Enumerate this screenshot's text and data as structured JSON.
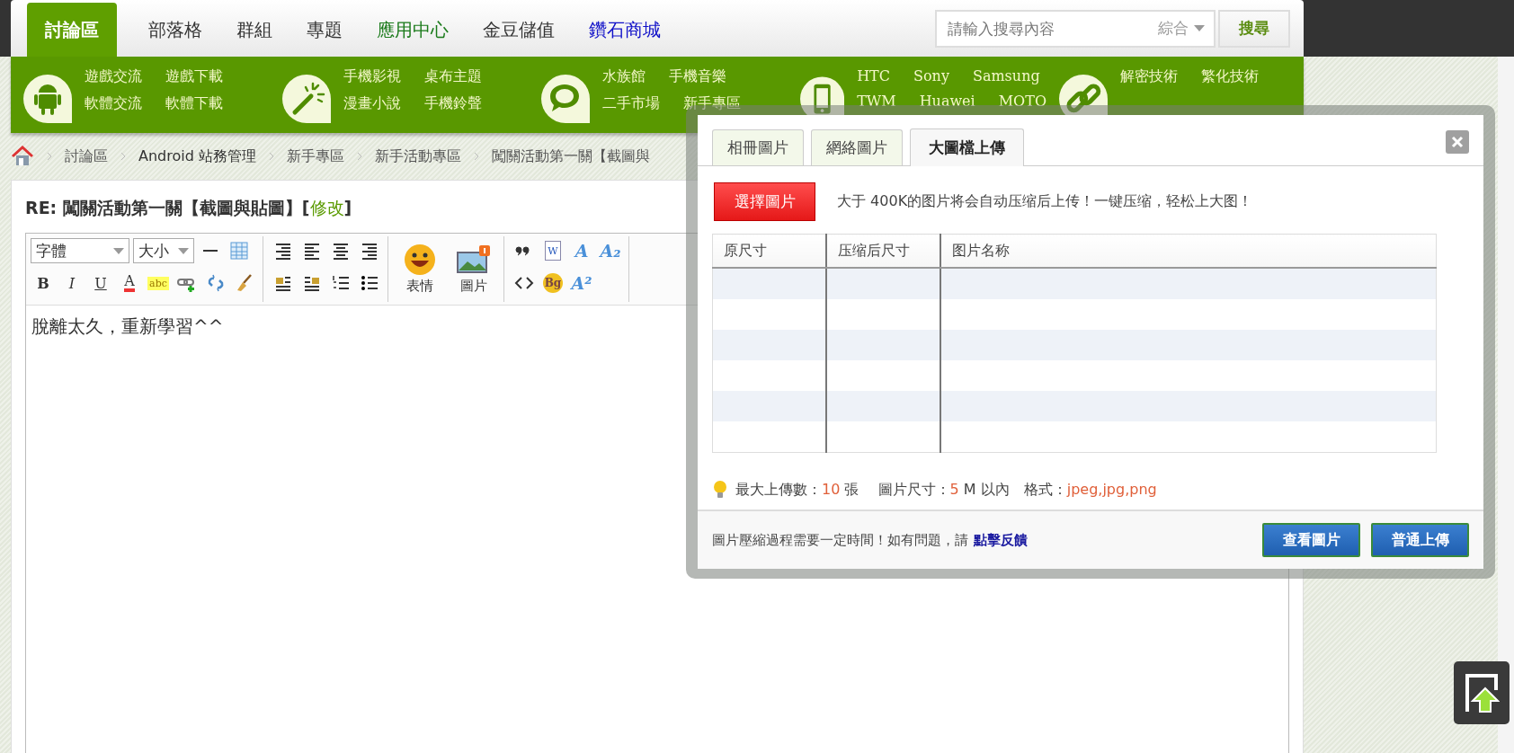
{
  "top_nav": {
    "items": [
      {
        "label": "討論區",
        "selected": true
      },
      {
        "label": "部落格",
        "selected": false,
        "color": "#333333"
      },
      {
        "label": "群組",
        "selected": false,
        "color": "#333333"
      },
      {
        "label": "專題",
        "selected": false,
        "color": "#333333"
      },
      {
        "label": "應用中心",
        "selected": false,
        "color": "#1a7a1a"
      },
      {
        "label": "金豆儲值",
        "selected": false,
        "color": "#333333"
      },
      {
        "label": "鑽石商城",
        "selected": false,
        "color": "#1010c8"
      }
    ],
    "search": {
      "placeholder": "請輸入搜尋內容",
      "scope": "綜合",
      "button": "搜尋"
    }
  },
  "categories": [
    {
      "links": [
        [
          "遊戲交流",
          "遊戲下載"
        ],
        [
          "軟體交流",
          "軟體下載"
        ]
      ]
    },
    {
      "links": [
        [
          "手機影視",
          "桌布主題"
        ],
        [
          "漫畫小說",
          "手機鈴聲"
        ]
      ]
    },
    {
      "links": [
        [
          "水族館",
          "手機音樂"
        ],
        [
          "二手市場",
          "新手專區"
        ]
      ]
    },
    {
      "links": [
        [
          "HTC",
          "Sony",
          "Samsung"
        ],
        [
          "TWM",
          "Huawei",
          "MOTO"
        ]
      ]
    },
    {
      "links": [
        [
          "解密技術",
          "繁化技術"
        ]
      ]
    }
  ],
  "breadcrumb": [
    {
      "label": "討論區",
      "strong": false
    },
    {
      "label": "Android 站務管理",
      "strong": true
    },
    {
      "label": "新手專區",
      "strong": false
    },
    {
      "label": "新手活動專區",
      "strong": false
    },
    {
      "label": "闖關活動第一關【截圖與",
      "strong": false
    }
  ],
  "post": {
    "title": "RE: 闖關活動第一關【截圖與貼圖】[",
    "edit_link": "修改",
    "title_end": "]",
    "toolbar": [
      {
        "top": [
          {
            "kind": "select",
            "label": "字體"
          },
          {
            "kind": "select",
            "label": "大小"
          },
          {
            "kind": "hr"
          },
          {
            "kind": "table"
          }
        ],
        "bottom": [
          {
            "kind": "bold",
            "glyph": "B"
          },
          {
            "kind": "italic",
            "glyph": "I"
          },
          {
            "kind": "underline",
            "glyph": "U"
          },
          {
            "kind": "forecolor",
            "glyph": "A"
          },
          {
            "kind": "highlight",
            "glyph": "abc"
          },
          {
            "kind": "link"
          },
          {
            "kind": "unlink"
          },
          {
            "kind": "eraser"
          }
        ]
      },
      {
        "top": [
          {
            "kind": "align-right"
          },
          {
            "kind": "align-left"
          },
          {
            "kind": "align-center"
          },
          {
            "kind": "align-right"
          }
        ],
        "bottom": [
          {
            "kind": "float-left"
          },
          {
            "kind": "float-right"
          },
          {
            "kind": "ordered-list"
          },
          {
            "kind": "bullet-list"
          }
        ]
      },
      {
        "big": [
          {
            "kind": "emoji",
            "label": "表情"
          },
          {
            "kind": "picture",
            "label": "圖片"
          }
        ]
      },
      {
        "top": [
          {
            "kind": "quote"
          },
          {
            "kind": "doc",
            "glyph": "W"
          },
          {
            "kind": "font",
            "glyph": "A"
          },
          {
            "kind": "font",
            "glyph": "A₂"
          }
        ],
        "bottom": [
          {
            "kind": "code"
          },
          {
            "kind": "bg",
            "glyph": "Bg"
          },
          {
            "kind": "font",
            "glyph": "A²"
          }
        ]
      }
    ],
    "body": "脫離太久，重新學習^^"
  },
  "dialog": {
    "tabs": [
      {
        "label": "相冊圖片",
        "selected": false
      },
      {
        "label": "網絡圖片",
        "selected": false
      },
      {
        "label": "大圖檔上傳",
        "selected": true
      }
    ],
    "choose_button": "選擇圖片",
    "hint": "大于 400K的图片将会自动压缩后上传！一键压缩，轻松上大图！",
    "columns": [
      "原尺寸",
      "压缩后尺寸",
      "图片名称"
    ],
    "limits": [
      {
        "text": "最大上傳數：",
        "highlight": false
      },
      {
        "text": "10",
        "highlight": true
      },
      {
        "text": " 張　 圖片尺寸：",
        "highlight": false
      },
      {
        "text": "5",
        "highlight": true
      },
      {
        "text": " M 以內　格式：",
        "highlight": false
      },
      {
        "text": "jpeg,jpg,png",
        "highlight": true
      }
    ],
    "footer_note": "圖片壓縮過程需要一定時間！如有問題，請",
    "feedback_link": "點擊反饋",
    "buttons": [
      "查看圖片",
      "普通上傳"
    ]
  }
}
